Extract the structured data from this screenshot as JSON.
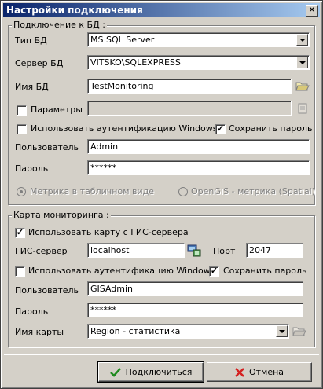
{
  "window": {
    "title": "Настройки подключения",
    "close_label": "×"
  },
  "db": {
    "legend": "Подключение к БД :",
    "type_label": "Тип БД",
    "type_value": "MS SQL Server",
    "server_label": "Сервер БД",
    "server_value": "VITSKO\\SQLEXPRESS",
    "name_label": "Имя БД",
    "name_value": "TestMonitoring",
    "params_label": "Параметры",
    "params_value": "",
    "windows_auth_label": "Использовать аутентификацию Windows",
    "save_password_label": "Сохранить пароль",
    "user_label": "Пользователь",
    "user_value": "Admin",
    "password_label": "Пароль",
    "password_value": "******",
    "metric_table_label": "Метрика в табличном виде",
    "metric_spatial_label": "OpenGIS - метрика (Spatial)"
  },
  "map": {
    "legend": "Карта мониторинга :",
    "use_gis_label": "Использовать карту с ГИС-сервера",
    "gis_server_label": "ГИС-сервер",
    "gis_server_value": "localhost",
    "port_label": "Порт",
    "port_value": "2047",
    "windows_auth_label": "Использовать аутентификацию Windows",
    "save_password_label": "Сохранить пароль",
    "user_label": "Пользователь",
    "user_value": "GISAdmin",
    "password_label": "Пароль",
    "password_value": "******",
    "map_name_label": "Имя карты",
    "map_name_value": "Region - статистика"
  },
  "buttons": {
    "connect_label": "Подключиться",
    "cancel_label": "Отмена"
  },
  "colors": {
    "title_start": "#0a246a",
    "title_end": "#a6caf0",
    "ok_green": "#1e8a1e",
    "cancel_red": "#d42020"
  }
}
